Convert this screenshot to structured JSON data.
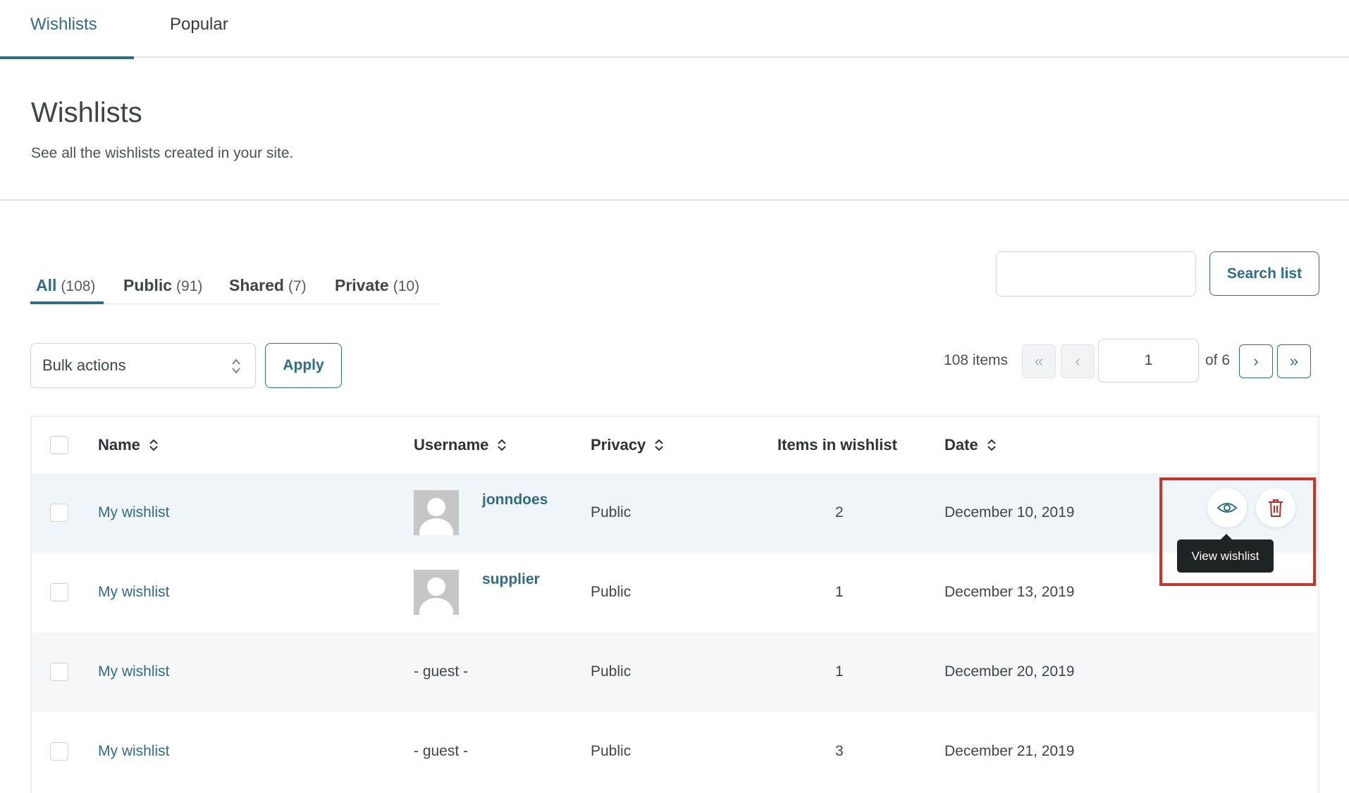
{
  "top_tabs": [
    {
      "label": "Wishlists",
      "active": true
    },
    {
      "label": "Popular",
      "active": false
    }
  ],
  "page": {
    "title": "Wishlists",
    "description": "See all the wishlists created in your site."
  },
  "filters": [
    {
      "label": "All",
      "count": "(108)",
      "active": true
    },
    {
      "label": "Public",
      "count": "(91)",
      "active": false
    },
    {
      "label": "Shared",
      "count": "(7)",
      "active": false
    },
    {
      "label": "Private",
      "count": "(10)",
      "active": false
    }
  ],
  "search": {
    "value": "",
    "button_label": "Search list"
  },
  "bulk": {
    "selected": "Bulk actions",
    "apply_label": "Apply"
  },
  "pagination": {
    "items_label": "108 items",
    "first": "«",
    "prev": "‹",
    "current_page": "1",
    "of_label": "of 6",
    "next": "›",
    "last": "»"
  },
  "table": {
    "columns": [
      "Name",
      "Username",
      "Privacy",
      "Items in wishlist",
      "Date"
    ],
    "rows": [
      {
        "name": "My wishlist",
        "username": "jonndoes",
        "has_avatar": true,
        "privacy": "Public",
        "items": "2",
        "date": "December 10, 2019"
      },
      {
        "name": "My wishlist",
        "username": "supplier",
        "has_avatar": true,
        "privacy": "Public",
        "items": "1",
        "date": "December 13, 2019"
      },
      {
        "name": "My wishlist",
        "username": "- guest -",
        "has_avatar": false,
        "privacy": "Public",
        "items": "1",
        "date": "December 20, 2019"
      },
      {
        "name": "My wishlist",
        "username": "- guest -",
        "has_avatar": false,
        "privacy": "Public",
        "items": "3",
        "date": "December 21, 2019"
      }
    ]
  },
  "row_actions": {
    "view_icon": "eye-icon",
    "delete_icon": "trash-icon",
    "tooltip": "View wishlist"
  },
  "colors": {
    "accent": "#2f6d84",
    "highlight": "#c9352a",
    "tooltip_bg": "#1e2326"
  }
}
